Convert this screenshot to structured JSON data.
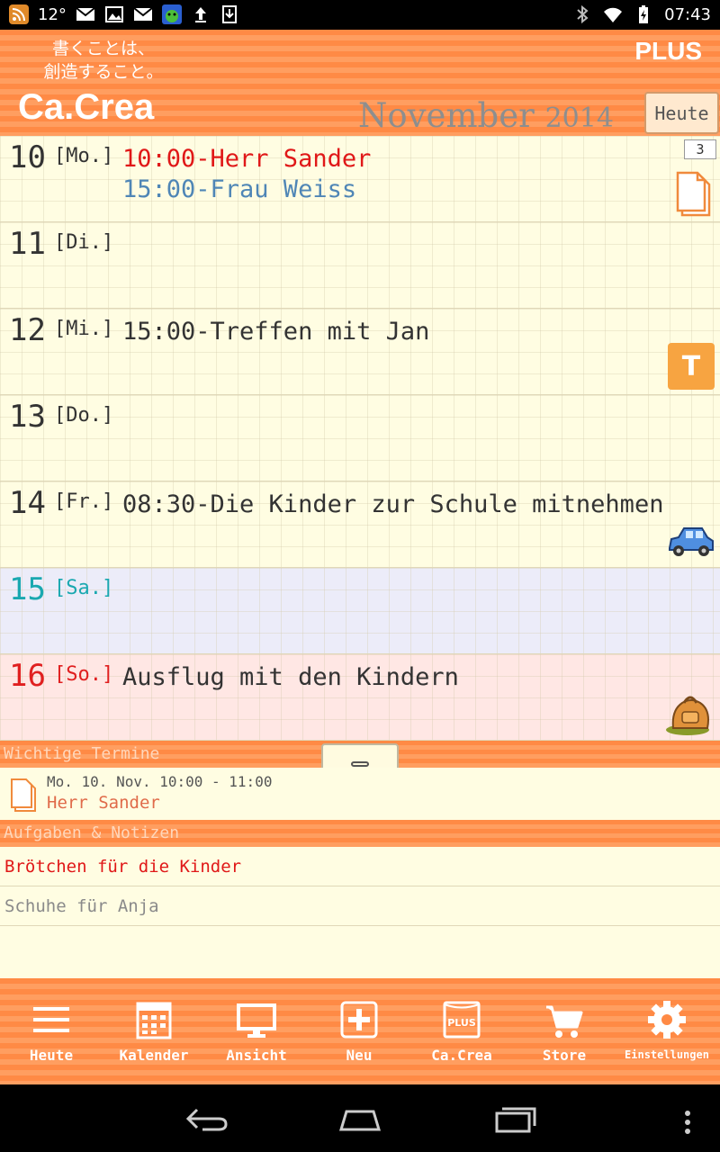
{
  "status_bar": {
    "temperature": "12°",
    "time": "07:43"
  },
  "header": {
    "slogan_line1": "書くことは、",
    "slogan_line2": "創造すること。",
    "brand": "Ca.Crea",
    "plus_badge": "PLUS",
    "month": "November",
    "year": "2014",
    "today_button": "Heute"
  },
  "week": [
    {
      "day": "10",
      "weekday": "[Mo.]",
      "events": [
        {
          "text": "10:00-Herr Sander",
          "color": "#e01818"
        },
        {
          "text": "15:00-Frau Weiss",
          "color": "#4f86b6"
        }
      ],
      "badge_count": "3",
      "icon": "note-icon"
    },
    {
      "day": "11",
      "weekday": "[Di.]",
      "events": []
    },
    {
      "day": "12",
      "weekday": "[Mi.]",
      "events": [
        {
          "text": "15:00-Treffen mit Jan"
        }
      ],
      "icon": "t-badge",
      "badge_letter": "T"
    },
    {
      "day": "13",
      "weekday": "[Do.]",
      "events": []
    },
    {
      "day": "14",
      "weekday": "[Fr.]",
      "events": [
        {
          "text": "08:30-Die Kinder zur Schule mitnehmen"
        }
      ],
      "icon": "car-icon"
    },
    {
      "day": "15",
      "weekday": "[Sa.]",
      "events": [],
      "type": "saturday"
    },
    {
      "day": "16",
      "weekday": "[So.]",
      "events": [
        {
          "text": "Ausflug mit den Kindern"
        }
      ],
      "icon": "backpack-icon",
      "type": "sunday"
    }
  ],
  "important": {
    "heading": "Wichtige Termine",
    "items": [
      {
        "date": "Mo. 10. Nov. 10:00 - 11:00",
        "title": "Herr Sander"
      }
    ]
  },
  "tasks": {
    "heading": "Aufgaben & Notizen",
    "items": [
      {
        "text": "Brötchen für die Kinder",
        "color": "#e01818"
      },
      {
        "text": "Schuhe für Anja",
        "color": "#8a8a8a"
      }
    ]
  },
  "toolbar": {
    "items": [
      {
        "label": "Heute",
        "icon": "menu-icon"
      },
      {
        "label": "Kalender",
        "icon": "calendar-icon"
      },
      {
        "label": "Ansicht",
        "icon": "monitor-icon"
      },
      {
        "label": "Neu",
        "icon": "plus-icon"
      },
      {
        "label": "Ca.Crea",
        "icon": "plus-book-icon",
        "icon_text": "PLUS"
      },
      {
        "label": "Store",
        "icon": "cart-icon"
      },
      {
        "label": "Einstellungen",
        "icon": "gear-icon"
      }
    ]
  },
  "colors": {
    "accent": "#ff8a45",
    "paper": "#fffde2",
    "saturday": "#ececf9",
    "sunday": "#ffe7e4"
  }
}
